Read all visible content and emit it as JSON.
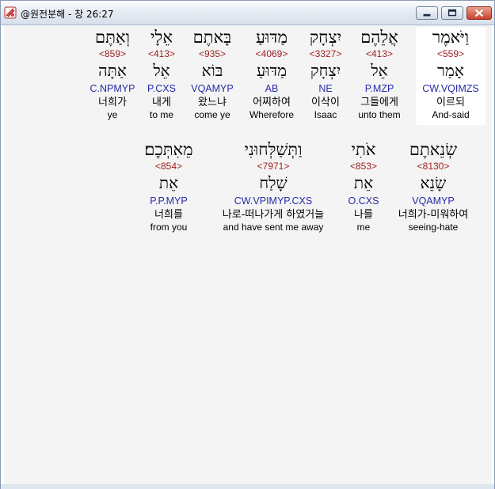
{
  "window": {
    "title": "@원전분해 - 창 26:27",
    "controls": {
      "minimize_icon": "minimize-icon",
      "maximize_icon": "maximize-icon",
      "close_icon": "close-icon"
    }
  },
  "colors": {
    "strong": "#a02020",
    "morph": "#2a2aa8",
    "pane_bg": "#f4f4f4",
    "highlight": "#ffffff"
  },
  "rows": [
    {
      "words": [
        {
          "hebrew": "וַיֹּאמֶר",
          "strong": "<559>",
          "lemma": "אָמַר",
          "morph": "CW.VQIMZS",
          "korean": "이르되",
          "english": "And-said",
          "highlighted": true
        },
        {
          "hebrew": "אֲלֵהֶם",
          "strong": "<413>",
          "lemma": "אֵל",
          "morph": "P.MZP",
          "korean": "그들에게",
          "english": "unto them",
          "highlighted": false
        },
        {
          "hebrew": "יִצְחָק",
          "strong": "<3327>",
          "lemma": "יִצְחָק",
          "morph": "NE",
          "korean": "이삭이",
          "english": "Isaac",
          "highlighted": false
        },
        {
          "hebrew": "מַדּוּעַ",
          "strong": "<4069>",
          "lemma": "מַדּוּעַ",
          "morph": "AB",
          "korean": "어찌하여",
          "english": "Wherefore",
          "highlighted": false
        },
        {
          "hebrew": "בָּאתֶם",
          "strong": "<935>",
          "lemma": "בּוֹא",
          "morph": "VQAMYP",
          "korean": "왔느냐",
          "english": "come ye",
          "highlighted": false
        },
        {
          "hebrew": "אֵלָי",
          "strong": "<413>",
          "lemma": "אֵל",
          "morph": "P.CXS",
          "korean": "내게",
          "english": "to me",
          "highlighted": false
        },
        {
          "hebrew": "וְאַתֶּם",
          "strong": "<859>",
          "lemma": "אַתָּה",
          "morph": "C.NPMYP",
          "korean": "너희가",
          "english": "ye",
          "highlighted": false
        }
      ]
    },
    {
      "words": [
        {
          "hebrew": "שְׂנֵאתֶם",
          "strong": "<8130>",
          "lemma": "שָׂנֵא",
          "morph": "VQAMYP",
          "korean": "너희가-미워하여",
          "english": "seeing-hate",
          "highlighted": false
        },
        {
          "hebrew": "אֹתִי",
          "strong": "<853>",
          "lemma": "אֵת",
          "morph": "O.CXS",
          "korean": "나를",
          "english": "me",
          "highlighted": false
        },
        {
          "hebrew": "וַתְּשַׁלְּחוּנִי",
          "strong": "<7971>",
          "lemma": "שָׁלַח",
          "morph": "CW.VPIMYP.CXS",
          "korean": "나로-떠나가게 하였거늘",
          "english": "and have sent me away",
          "highlighted": false
        },
        {
          "hebrew": "מֵאִתְּכֶם׃",
          "strong": "<854>",
          "lemma": "אֵת",
          "morph": "P.P.MYP",
          "korean": "너희를",
          "english": "from you",
          "highlighted": false
        }
      ]
    }
  ]
}
